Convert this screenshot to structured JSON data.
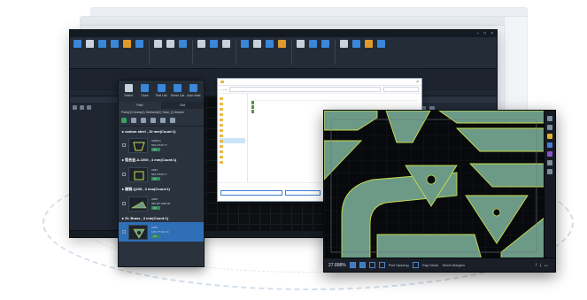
{
  "partpanel": {
    "tools": [
      {
        "label": "Select"
      },
      {
        "label": "Draw"
      },
      {
        "label": "Part List"
      },
      {
        "label": "Sheet List"
      },
      {
        "label": "Auto Nest"
      }
    ],
    "tabs": [
      "Part",
      "Sht"
    ],
    "info": "Parts(4) Nests(4) Selected(0) Total_Q Nested",
    "groups": [
      {
        "label": "carbon steel , 10 mm(Count:1)",
        "items": [
          {
            "name": "A##0(1)",
            "size": "595.2*335.77",
            "qty": "0/1",
            "selected": false
          }
        ]
      },
      {
        "label": "铝合金-A-1000 , 4 mm(Count:1)",
        "items": [
          {
            "name": "A##1",
            "size": "595.2*335.77",
            "qty": "0/1",
            "selected": false
          }
        ]
      },
      {
        "label": "碳钢-Q235 , 3 mm(Count:1)",
        "items": [
          {
            "name": "A##2",
            "size": "385.00*1098.95",
            "qty": "0/1",
            "selected": false
          }
        ]
      },
      {
        "label": "SI- Brass , 3 mm(Count:1)",
        "items": [
          {
            "name": "A##3",
            "size": "135.77*130.04",
            "qty": "0/1",
            "selected": true
          }
        ]
      }
    ]
  },
  "nestview": {
    "zoom": "27.898%",
    "part_spacing": "Part Spacing",
    "gap_mode": "Gap Mode",
    "sheet_margins": "Sheet Margins"
  },
  "colors": {
    "part_fill": "#6c9a87",
    "part_edge": "#c8dd4b",
    "accent": "#2e6fb8"
  }
}
